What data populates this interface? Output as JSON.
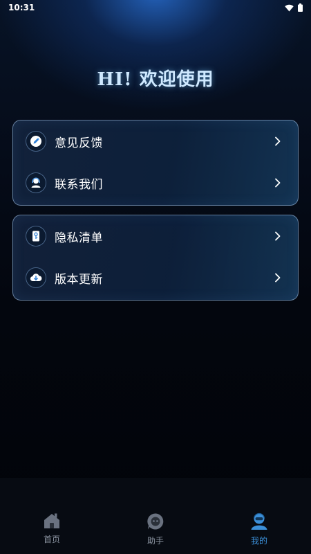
{
  "status_bar": {
    "time": "10:31"
  },
  "greeting": "HI! 欢迎使用",
  "menu_groups": [
    {
      "items": [
        {
          "label": "意见反馈",
          "icon": "feedback-icon"
        },
        {
          "label": "联系我们",
          "icon": "contact-icon"
        }
      ]
    },
    {
      "items": [
        {
          "label": "隐私清单",
          "icon": "privacy-icon"
        },
        {
          "label": "版本更新",
          "icon": "update-icon"
        }
      ]
    }
  ],
  "tab_bar": {
    "tabs": [
      {
        "label": "首页",
        "icon": "home-icon",
        "active": false
      },
      {
        "label": "助手",
        "icon": "assistant-icon",
        "active": false
      },
      {
        "label": "我的",
        "icon": "profile-icon",
        "active": true
      }
    ]
  },
  "colors": {
    "accent": "#3b8fd8",
    "inactive_tab": "#8d96a3",
    "card_border": "#aac8eb"
  }
}
